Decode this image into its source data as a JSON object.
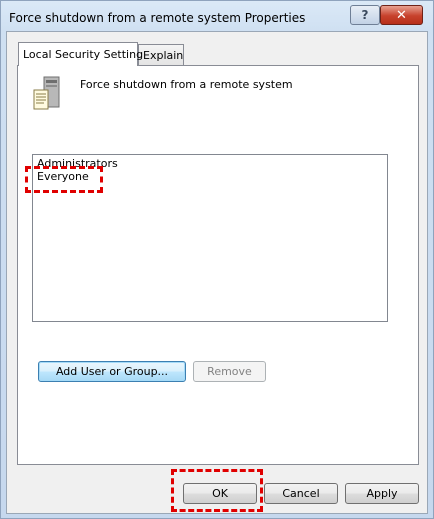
{
  "window": {
    "title": "Force shutdown from a remote system Properties",
    "help_glyph": "?",
    "close_glyph": "✕"
  },
  "tabs": [
    {
      "label": "Local Security Setting",
      "active": true
    },
    {
      "label": "Explain",
      "active": false
    }
  ],
  "policy": {
    "icon": "server-policy-icon",
    "name": "Force shutdown from a remote system"
  },
  "users_list": {
    "items": [
      "Administrators",
      "Everyone"
    ]
  },
  "buttons": {
    "add": "Add User or Group...",
    "remove": "Remove",
    "ok": "OK",
    "cancel": "Cancel",
    "apply": "Apply"
  },
  "colors": {
    "highlight": "#e00000",
    "title_gradient_top": "#dbe9f7",
    "close_button": "#c7412c"
  }
}
